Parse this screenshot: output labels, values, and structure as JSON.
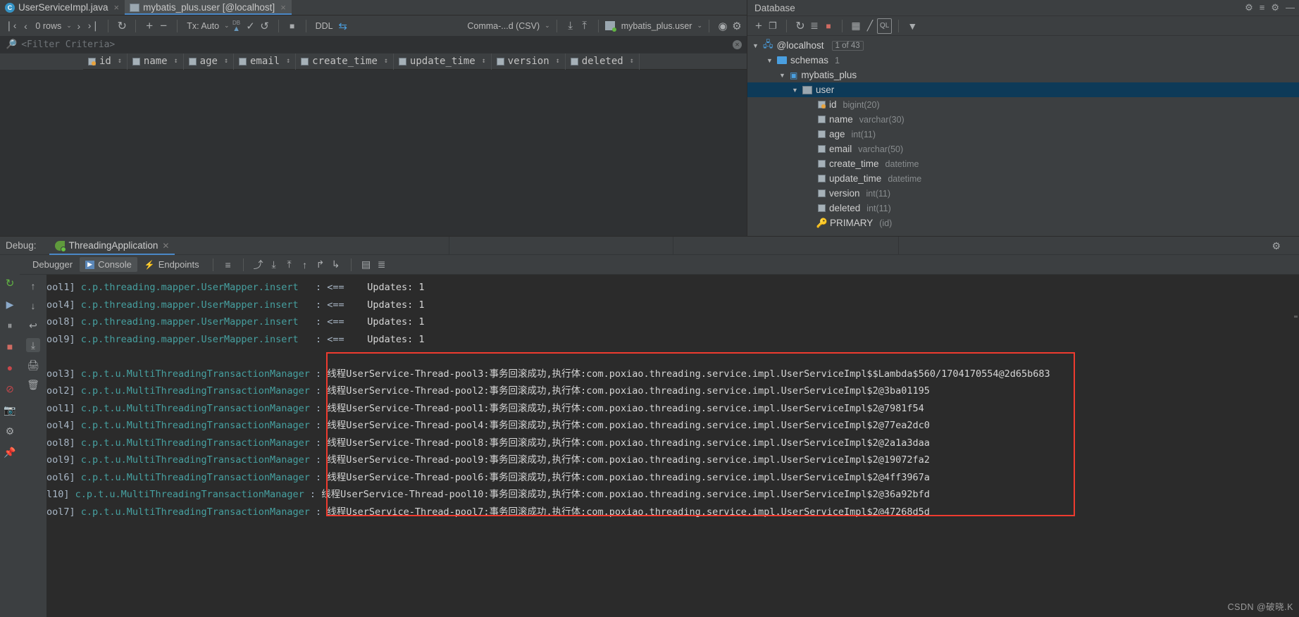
{
  "editor_tabs": [
    {
      "label": "UserServiceImpl.java",
      "icon": "java-class-icon",
      "active": false,
      "close": "×"
    },
    {
      "label": "mybatis_plus.user [@localhost]",
      "icon": "db-table-icon",
      "active": true,
      "close": "×"
    }
  ],
  "data_toolbar": {
    "first_page": "❘‹",
    "prev_page": "‹",
    "rows_label": "0 rows",
    "rows_caret": "⌄",
    "next_page": "›",
    "last_page": "›❘",
    "reload": "↻",
    "add_row": "+",
    "delete_row": "−",
    "tx_label": "Tx: Auto",
    "tx_caret": "⌄",
    "submit": "DB",
    "commit": "✓",
    "rollback": "↺",
    "stop": "■",
    "ddl_label": "DDL",
    "export_format": "Comma-...d (CSV)",
    "export_caret": "⌄",
    "download": "⤓",
    "upload": "⤒",
    "schema_label": "mybatis_plus.user",
    "schema_caret": "⌄",
    "view_options": "◉",
    "settings": "⚙"
  },
  "filter_bar": {
    "search_icon": "search-icon",
    "placeholder": "<Filter Criteria>",
    "close": "✕"
  },
  "grid_columns": [
    {
      "name": "id",
      "icon": "column-key-icon",
      "sort": "↕"
    },
    {
      "name": "name",
      "icon": "column-icon",
      "sort": "↕"
    },
    {
      "name": "age",
      "icon": "column-icon",
      "sort": "↕"
    },
    {
      "name": "email",
      "icon": "column-icon",
      "sort": "↕"
    },
    {
      "name": "create_time",
      "icon": "column-icon",
      "sort": "↕"
    },
    {
      "name": "update_time",
      "icon": "column-icon",
      "sort": "↕"
    },
    {
      "name": "version",
      "icon": "column-icon",
      "sort": "↕"
    },
    {
      "name": "deleted",
      "icon": "column-icon",
      "sort": "↕"
    }
  ],
  "database_panel": {
    "title": "Database",
    "title_icons": [
      "help-icon",
      "collapse-all-icon",
      "gear-icon",
      "hide-icon"
    ],
    "toolbar": [
      "add-icon",
      "copy-icon",
      "refresh-icon",
      "run-script-icon",
      "stop-icon",
      "table-icon",
      "edit-icon",
      "console-icon",
      "filter-icon"
    ],
    "tree": [
      {
        "indent": 0,
        "twist": "▼",
        "icon": "datasource-icon",
        "label": "@localhost",
        "badge": "1 of 43",
        "type": "",
        "selected": false
      },
      {
        "indent": 1,
        "twist": "▼",
        "icon": "folder-icon",
        "label": "schemas",
        "badge": "",
        "type": "1",
        "selected": false
      },
      {
        "indent": 2,
        "twist": "▼",
        "icon": "schema-icon",
        "label": "mybatis_plus",
        "badge": "",
        "type": "",
        "selected": false
      },
      {
        "indent": 3,
        "twist": "▼",
        "icon": "table-icon",
        "label": "user",
        "badge": "",
        "type": "",
        "selected": true
      },
      {
        "indent": 4,
        "twist": "",
        "icon": "primary-key-icon",
        "label": "id",
        "badge": "",
        "type": "bigint(20)",
        "selected": false
      },
      {
        "indent": 4,
        "twist": "",
        "icon": "column-icon",
        "label": "name",
        "badge": "",
        "type": "varchar(30)",
        "selected": false
      },
      {
        "indent": 4,
        "twist": "",
        "icon": "column-icon",
        "label": "age",
        "badge": "",
        "type": "int(11)",
        "selected": false
      },
      {
        "indent": 4,
        "twist": "",
        "icon": "column-icon",
        "label": "email",
        "badge": "",
        "type": "varchar(50)",
        "selected": false
      },
      {
        "indent": 4,
        "twist": "",
        "icon": "column-icon",
        "label": "create_time",
        "badge": "",
        "type": "datetime",
        "selected": false
      },
      {
        "indent": 4,
        "twist": "",
        "icon": "column-icon",
        "label": "update_time",
        "badge": "",
        "type": "datetime",
        "selected": false
      },
      {
        "indent": 4,
        "twist": "",
        "icon": "column-icon",
        "label": "version",
        "badge": "",
        "type": "int(11)",
        "selected": false
      },
      {
        "indent": 4,
        "twist": "",
        "icon": "column-icon",
        "label": "deleted",
        "badge": "",
        "type": "int(11)",
        "selected": false
      },
      {
        "indent": 4,
        "twist": "",
        "icon": "key-icon",
        "label": "PRIMARY",
        "badge": "",
        "type": "(id)",
        "selected": false
      }
    ]
  },
  "debug_window": {
    "label": "Debug:",
    "run_config": "ThreadingApplication",
    "run_config_close": "✕",
    "settings_icon": "gear-icon",
    "tabs": [
      {
        "label": "Debugger",
        "icon": "",
        "active": false
      },
      {
        "label": "Console",
        "icon": "console-icon",
        "active": true
      },
      {
        "label": "Endpoints",
        "icon": "endpoints-icon",
        "active": false
      }
    ],
    "tab_icons": [
      "layout-icon",
      "stack-up-icon",
      "step-over-icon",
      "step-into-icon",
      "step-out-icon",
      "run-to-cursor-icon",
      "evaluate-icon",
      "mute-icon"
    ],
    "left_gutter_icons": [
      "rerun-icon",
      "pause-icon",
      "stop-icon",
      "view-breakpoints-icon",
      "mute-breakpoints-icon",
      "camera-icon",
      "settings-icon",
      "pin-icon"
    ],
    "mid_gutter_icons": [
      "up-icon",
      "down-icon",
      "soft-wrap-icon",
      "scroll-end-icon",
      "print-icon",
      "trash-icon"
    ]
  },
  "console_lines": [
    {
      "thread": "ool1]",
      "logger": "c.p.threading.mapper.UserMapper.insert",
      "sep": ": <==",
      "msg": "Updates: 1",
      "type": "insert"
    },
    {
      "thread": "ool4]",
      "logger": "c.p.threading.mapper.UserMapper.insert",
      "sep": ": <==",
      "msg": "Updates: 1",
      "type": "insert"
    },
    {
      "thread": "ool8]",
      "logger": "c.p.threading.mapper.UserMapper.insert",
      "sep": ": <==",
      "msg": "Updates: 1",
      "type": "insert"
    },
    {
      "thread": "ool9]",
      "logger": "c.p.threading.mapper.UserMapper.insert",
      "sep": ": <==",
      "msg": "Updates: 1",
      "type": "insert"
    },
    {
      "thread": "",
      "logger": "",
      "sep": "",
      "msg": "",
      "type": "blank"
    },
    {
      "thread": "ool3]",
      "logger": "c.p.t.u.MultiThreadingTransactionManager",
      "sep": ":",
      "msg": "线程UserService-Thread-pool3:事务回滚成功,执行体:com.poxiao.threading.service.impl.UserServiceImpl$$Lambda$560/1704170554@2d65b683",
      "type": "tx"
    },
    {
      "thread": "ool2]",
      "logger": "c.p.t.u.MultiThreadingTransactionManager",
      "sep": ":",
      "msg": "线程UserService-Thread-pool2:事务回滚成功,执行体:com.poxiao.threading.service.impl.UserServiceImpl$2@3ba01195",
      "type": "tx"
    },
    {
      "thread": "ool1]",
      "logger": "c.p.t.u.MultiThreadingTransactionManager",
      "sep": ":",
      "msg": "线程UserService-Thread-pool1:事务回滚成功,执行体:com.poxiao.threading.service.impl.UserServiceImpl$2@7981f54",
      "type": "tx"
    },
    {
      "thread": "ool4]",
      "logger": "c.p.t.u.MultiThreadingTransactionManager",
      "sep": ":",
      "msg": "线程UserService-Thread-pool4:事务回滚成功,执行体:com.poxiao.threading.service.impl.UserServiceImpl$2@77ea2dc0",
      "type": "tx"
    },
    {
      "thread": "ool8]",
      "logger": "c.p.t.u.MultiThreadingTransactionManager",
      "sep": ":",
      "msg": "线程UserService-Thread-pool8:事务回滚成功,执行体:com.poxiao.threading.service.impl.UserServiceImpl$2@2a1a3daa",
      "type": "tx"
    },
    {
      "thread": "ool9]",
      "logger": "c.p.t.u.MultiThreadingTransactionManager",
      "sep": ":",
      "msg": "线程UserService-Thread-pool9:事务回滚成功,执行体:com.poxiao.threading.service.impl.UserServiceImpl$2@19072fa2",
      "type": "tx"
    },
    {
      "thread": "ool6]",
      "logger": "c.p.t.u.MultiThreadingTransactionManager",
      "sep": ":",
      "msg": "线程UserService-Thread-pool6:事务回滚成功,执行体:com.poxiao.threading.service.impl.UserServiceImpl$2@4ff3967a",
      "type": "tx"
    },
    {
      "thread": "l10]",
      "logger": "c.p.t.u.MultiThreadingTransactionManager",
      "sep": ":",
      "msg": "线程UserService-Thread-pool10:事务回滚成功,执行体:com.poxiao.threading.service.impl.UserServiceImpl$2@36a92bfd",
      "type": "tx"
    },
    {
      "thread": "ool7]",
      "logger": "c.p.t.u.MultiThreadingTransactionManager",
      "sep": ":",
      "msg": "线程UserService-Thread-pool7:事务回滚成功,执行体:com.poxiao.threading.service.impl.UserServiceImpl$2@47268d5d",
      "type": "tx"
    }
  ],
  "watermark": "CSDN @破晓.K",
  "colors": {
    "accent": "#4a88c7",
    "selection": "#0d3a58",
    "highlight_box": "#ee3b2f",
    "logger_text": "#46a0a0",
    "bg_panel": "#3c3f41",
    "bg_console": "#2b2b2b"
  }
}
